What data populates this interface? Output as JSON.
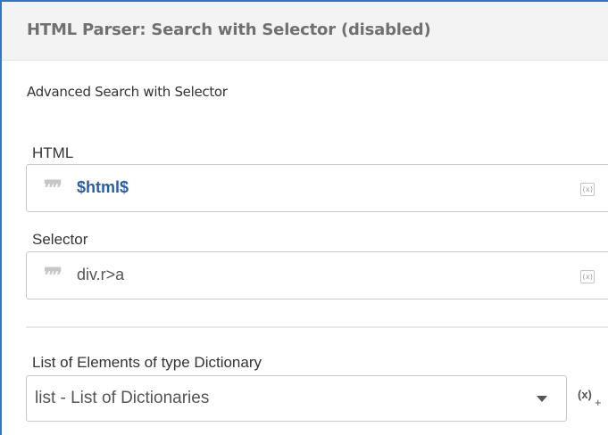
{
  "panel": {
    "title": "HTML Parser: Search with Selector (disabled)",
    "description": "Advanced Search with Selector",
    "accent_color": "#3b73b9"
  },
  "fields": {
    "html": {
      "label": "HTML",
      "value": "$html$",
      "icon": "quote-icon",
      "var_icon_text": "(x)"
    },
    "selector": {
      "label": "Selector",
      "value": "div.r>a",
      "icon": "quote-icon",
      "var_icon_text": "(x)"
    }
  },
  "output": {
    "label": "List of Elements of type Dictionary",
    "selected": "list - List of Dictionaries",
    "dropdown_icon": "chevron-down-icon",
    "add_var_text": "(x)",
    "add_var_plus": "+"
  }
}
